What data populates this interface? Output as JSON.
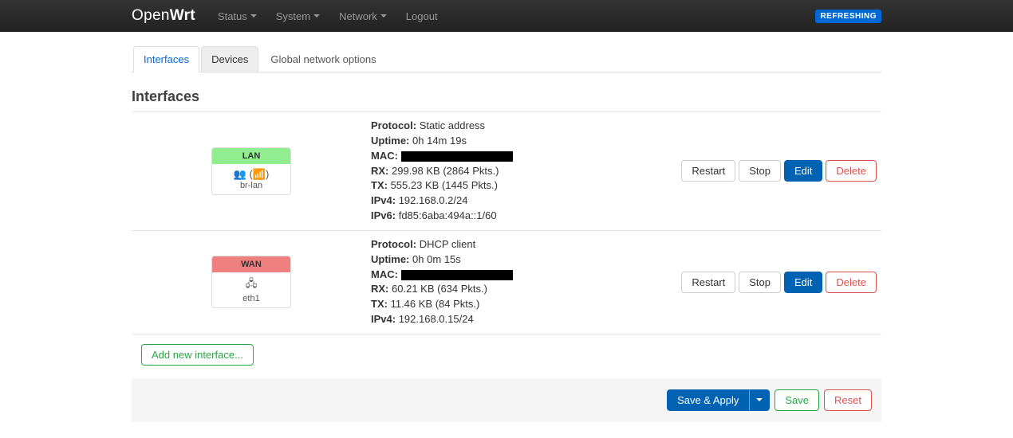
{
  "navbar": {
    "brand_prefix": "Open",
    "brand_suffix": "Wrt",
    "menu": [
      "Status",
      "System",
      "Network"
    ],
    "logout": "Logout",
    "badge": "REFRESHING"
  },
  "tabs": {
    "interfaces": "Interfaces",
    "devices": "Devices",
    "global": "Global network options"
  },
  "heading": "Interfaces",
  "labels": {
    "protocol": "Protocol:",
    "uptime": "Uptime:",
    "mac": "MAC:",
    "rx": "RX:",
    "tx": "TX:",
    "ipv4": "IPv4:",
    "ipv6": "IPv6:"
  },
  "interfaces": [
    {
      "name": "LAN",
      "device_display": "(📶)",
      "device": "br-lan",
      "color_class": "lan",
      "protocol": "Static address",
      "uptime": "0h 14m 19s",
      "rx": "299.98 KB (2864 Pkts.)",
      "tx": "555.23 KB (1445 Pkts.)",
      "ipv4": "192.168.0.2/24",
      "ipv6": "fd85:6aba:494a::1/60"
    },
    {
      "name": "WAN",
      "device_display": "",
      "device": "eth1",
      "color_class": "wan",
      "protocol": "DHCP client",
      "uptime": "0h 0m 15s",
      "rx": "60.21 KB (634 Pkts.)",
      "tx": "11.46 KB (84 Pkts.)",
      "ipv4": "192.168.0.15/24",
      "ipv6": null
    }
  ],
  "buttons": {
    "restart": "Restart",
    "stop": "Stop",
    "edit": "Edit",
    "delete": "Delete",
    "add": "Add new interface...",
    "save_apply": "Save & Apply",
    "save": "Save",
    "reset": "Reset"
  }
}
